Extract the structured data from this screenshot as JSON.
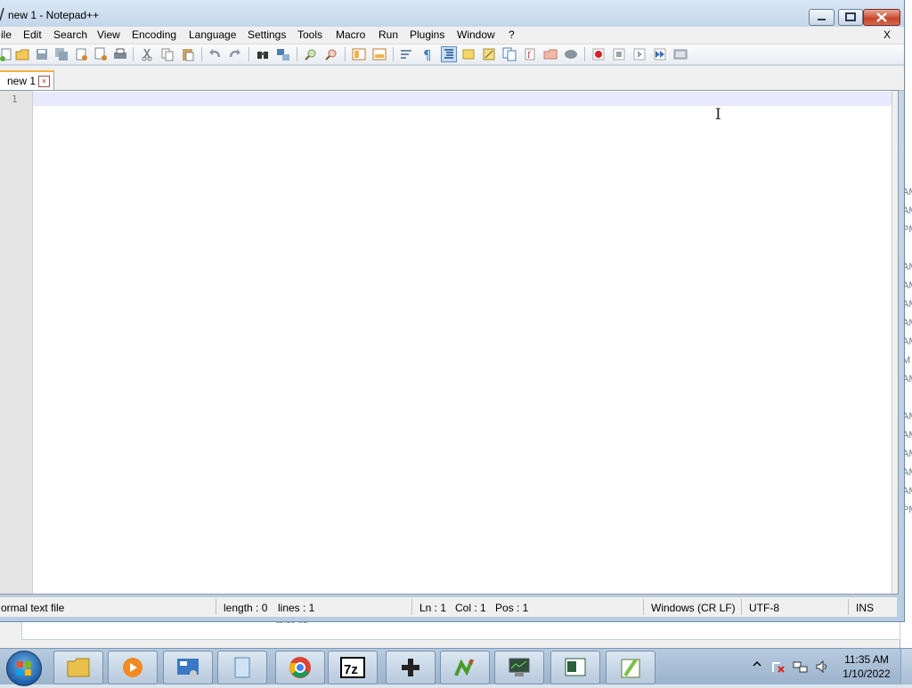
{
  "window": {
    "title": "new 1 - Notepad++"
  },
  "menu": {
    "items": [
      "ile",
      "Edit",
      "Search",
      "View",
      "Encoding",
      "Language",
      "Settings",
      "Tools",
      "Macro",
      "Run",
      "Plugins",
      "Window",
      "?"
    ],
    "close_x": "X"
  },
  "tabs": [
    {
      "label": "new 1",
      "active": true
    }
  ],
  "editor": {
    "line_numbers": [
      "1"
    ],
    "content": ""
  },
  "status": {
    "file_type": "ormal text file",
    "length": "length : 0",
    "lines": "lines : 1",
    "ln": "Ln : 1",
    "col": "Col : 1",
    "pos": "Pos : 1",
    "eol": "Windows (CR LF)",
    "encoding": "UTF-8",
    "mode": "INS"
  },
  "background": {
    "time_suffixes": [
      "AM",
      "AM",
      "PM",
      "AM",
      "AM",
      "AM",
      "AM",
      "AM",
      "M",
      "AM",
      "AM",
      "AM",
      "AM",
      "AM",
      "AM",
      "PM"
    ],
    "bottom_text": "ance ed"
  },
  "taskbar": {
    "time": "11:35 AM",
    "date": "1/10/2022",
    "apps": [
      "folder-icon",
      "media-player-icon",
      "control-panel-icon",
      "notepad-icon",
      "chrome-icon",
      "7zip-icon",
      "gamepad-icon",
      "sigil-icon",
      "network-monitor-icon",
      "document-viewer-icon",
      "notepad-plus-plus-icon"
    ]
  },
  "colors": {
    "close_red": "#c8462b",
    "tab_active_accent": "#fab13c",
    "current_line": "#e8e8ff"
  }
}
